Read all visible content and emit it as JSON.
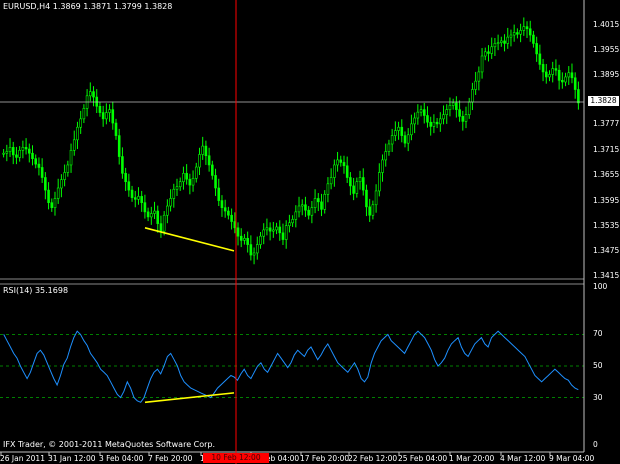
{
  "header": {
    "symbol_info": "EURUSD,H4  1.3869 1.3871 1.3799 1.3828"
  },
  "rsi_header": {
    "label": "RSI(14) 35.1698"
  },
  "footer": {
    "copyright": "IFX Trader, © 2001-2011 MetaQuotes Software Corp."
  },
  "price_axis": {
    "ticks": [
      "1.4015",
      "1.3955",
      "1.3895",
      "1.3835",
      "1.3777",
      "1.3715",
      "1.3655",
      "1.3595",
      "1.3535",
      "1.3475",
      "1.3415"
    ],
    "current_price": "1.3828"
  },
  "rsi_axis": {
    "ticks": [
      "100",
      "70",
      "50",
      "30",
      "0"
    ]
  },
  "time_axis": {
    "ticks": [
      "26 Jan 2011",
      "31 Jan 12:00",
      "3 Feb 04:00",
      "7 Feb 20:00",
      "10 Feb 12:00",
      "15 Feb 04:00",
      "17 Feb 20:00",
      "22 Feb 12:00",
      "25 Feb 04:00",
      "1 Mar 20:00",
      "4 Mar 12:00",
      "9 Mar 04:00"
    ],
    "cursor_label": "10 Feb 12:00"
  },
  "colors": {
    "background": "#000000",
    "candle": "#00ff00",
    "rsi_line": "#1e90ff",
    "level_line": "#00aa00",
    "divergence_line": "#ffff00",
    "cursor_line": "#ff0000",
    "grid_line": "#c0c0c0"
  },
  "chart_data": [
    {
      "type": "candlestick",
      "title": "EURUSD,H4",
      "ylim": [
        1.3415,
        1.4045
      ],
      "close_series": [
        1.3708,
        1.3712,
        1.3722,
        1.3704,
        1.3698,
        1.3715,
        1.3722,
        1.3718,
        1.3708,
        1.3695,
        1.3682,
        1.3674,
        1.365,
        1.362,
        1.359,
        1.3578,
        1.36,
        1.3625,
        1.3645,
        1.3662,
        1.368,
        1.3715,
        1.374,
        1.377,
        1.379,
        1.3815,
        1.3845,
        1.3855,
        1.3842,
        1.382,
        1.3805,
        1.379,
        1.3805,
        1.3812,
        1.378,
        1.375,
        1.37,
        1.366,
        1.364,
        1.362,
        1.3602,
        1.3598,
        1.3605,
        1.359,
        1.3568,
        1.3556,
        1.3564,
        1.357,
        1.354,
        1.3522,
        1.356,
        1.3582,
        1.36,
        1.3622,
        1.3628,
        1.364,
        1.366,
        1.3646,
        1.3632,
        1.3648,
        1.3675,
        1.3705,
        1.3725,
        1.3702,
        1.368,
        1.3655,
        1.3625,
        1.3595,
        1.3578,
        1.357,
        1.356,
        1.3545,
        1.353,
        1.351,
        1.35,
        1.3505,
        1.349,
        1.3465,
        1.347,
        1.349,
        1.351,
        1.3525,
        1.353,
        1.3522,
        1.3525,
        1.3532,
        1.3518,
        1.3502,
        1.3535,
        1.3542,
        1.355,
        1.3568,
        1.3582,
        1.3585,
        1.3572,
        1.356,
        1.3578,
        1.36,
        1.3592,
        1.3574,
        1.361,
        1.3635,
        1.365,
        1.368,
        1.3692,
        1.3686,
        1.3678,
        1.365,
        1.363,
        1.3612,
        1.364,
        1.365,
        1.362,
        1.358,
        1.356,
        1.3585,
        1.3618,
        1.3662,
        1.3692,
        1.3712,
        1.373,
        1.375,
        1.3762,
        1.377,
        1.375,
        1.3732,
        1.3752,
        1.3778,
        1.3792,
        1.3806,
        1.3812,
        1.3798,
        1.3782,
        1.3772,
        1.3782,
        1.3778,
        1.379,
        1.38,
        1.3812,
        1.3822,
        1.3828,
        1.3812,
        1.3796,
        1.3784,
        1.38,
        1.383,
        1.386,
        1.388,
        1.3902,
        1.394,
        1.395,
        1.3946,
        1.3962,
        1.397,
        1.3972,
        1.3976,
        1.397,
        1.3985,
        1.399,
        1.3996,
        1.3992,
        1.4001,
        1.401,
        1.4005,
        1.399,
        1.397,
        1.3945,
        1.392,
        1.3902,
        1.389,
        1.3896,
        1.391,
        1.3906,
        1.3882,
        1.3878,
        1.389,
        1.39,
        1.3888,
        1.386,
        1.3828
      ],
      "divergence_line": {
        "from": [
          1.353
        ],
        "to": [
          1.3475
        ]
      }
    },
    {
      "type": "line",
      "title": "RSI(14) 35.1698",
      "ylim": [
        0,
        100
      ],
      "levels": [
        30,
        50,
        70
      ],
      "series": [
        {
          "values": [
            70,
            66,
            62,
            58,
            55,
            50,
            46,
            42,
            46,
            52,
            58,
            60,
            57,
            52,
            47,
            42,
            38,
            44,
            51,
            55,
            62,
            68,
            72,
            70,
            66,
            63,
            58,
            55,
            52,
            48,
            46,
            44,
            40,
            36,
            32,
            30,
            34,
            40,
            36,
            30,
            28,
            27,
            30,
            36,
            42,
            46,
            48,
            45,
            50,
            56,
            58,
            54,
            50,
            44,
            40,
            38,
            36,
            35,
            34,
            33,
            32,
            31,
            30,
            33,
            36,
            38,
            40,
            42,
            44,
            43,
            41,
            45,
            48,
            44,
            42,
            46,
            50,
            52,
            48,
            46,
            50,
            54,
            58,
            55,
            52,
            49,
            52,
            57,
            60,
            58,
            56,
            60,
            62,
            58,
            54,
            57,
            61,
            64,
            60,
            56,
            52,
            50,
            48,
            46,
            49,
            52,
            48,
            42,
            40,
            43,
            52,
            58,
            62,
            66,
            68,
            70,
            66,
            64,
            62,
            60,
            58,
            62,
            66,
            70,
            72,
            70,
            68,
            64,
            60,
            54,
            50,
            52,
            55,
            60,
            64,
            66,
            68,
            62,
            58,
            56,
            60,
            64,
            66,
            68,
            64,
            62,
            68,
            70,
            72,
            70,
            68,
            66,
            64,
            62,
            60,
            58,
            56,
            52,
            48,
            44,
            42,
            40,
            42,
            44,
            46,
            48,
            46,
            44,
            42,
            41,
            38,
            36,
            35
          ]
        }
      ],
      "divergence_line": {
        "from": [
          27
        ],
        "to": [
          33
        ]
      }
    }
  ]
}
